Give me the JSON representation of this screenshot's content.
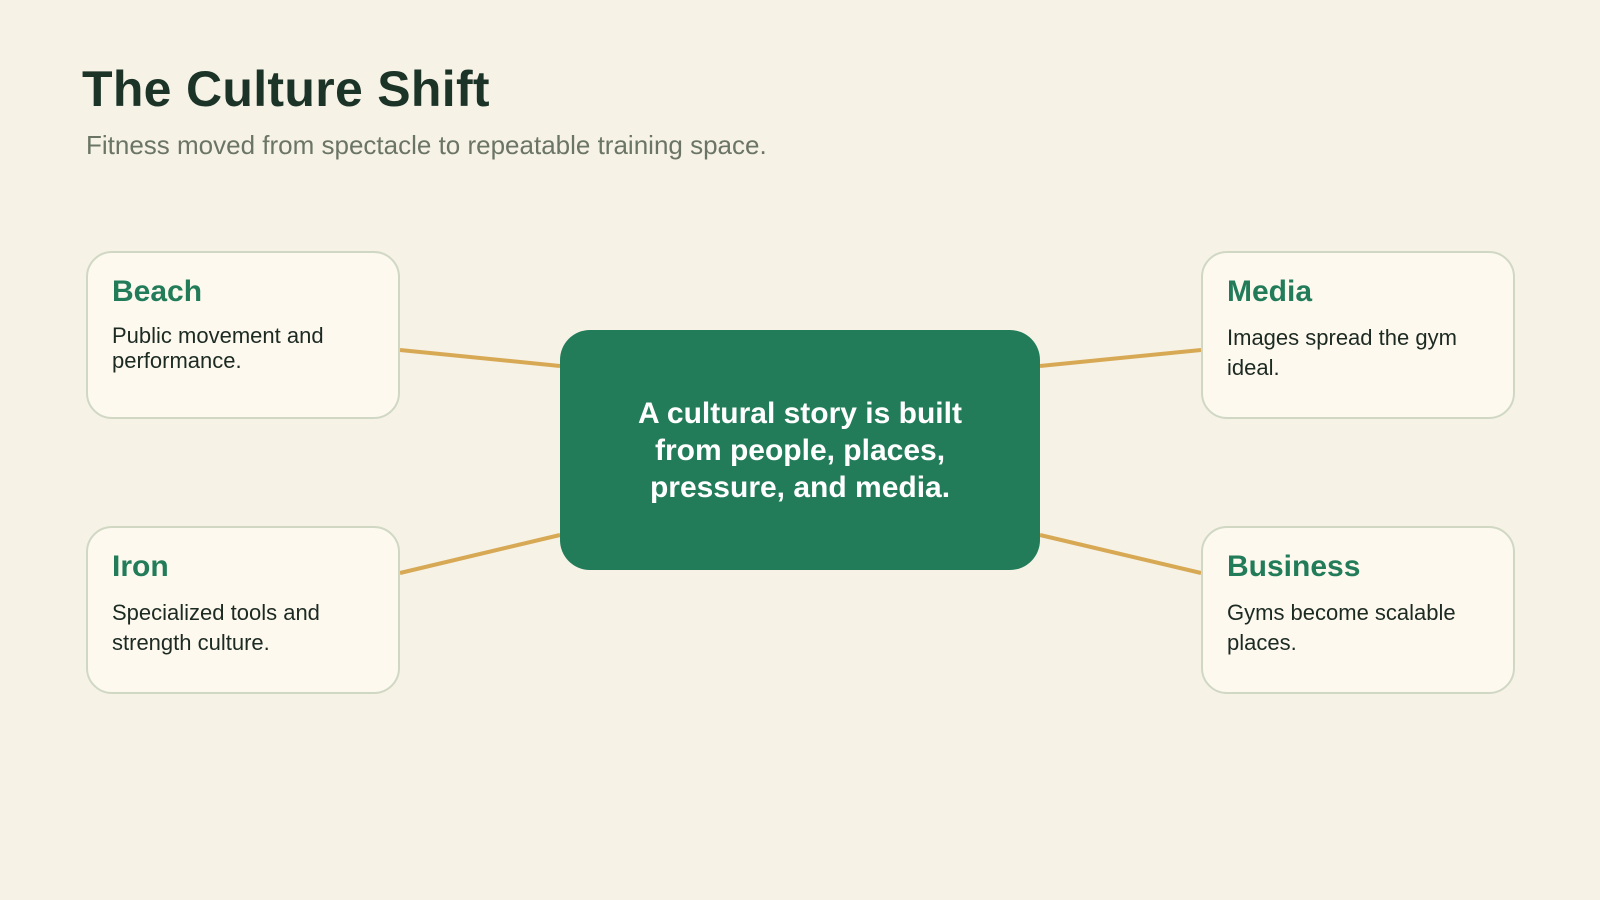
{
  "header": {
    "title": "The Culture Shift",
    "subtitle": "Fitness moved from spectacle to repeatable training space."
  },
  "center": {
    "text": "A cultural story is built from people, places, pressure, and media."
  },
  "cards": [
    {
      "title": "Beach",
      "text": "Public movement and performance."
    },
    {
      "title": "Media",
      "text": "Images spread the gym ideal."
    },
    {
      "title": "Iron",
      "text": "Specialized tools and strength culture."
    },
    {
      "title": "Business",
      "text": "Gyms become scalable places."
    }
  ],
  "colors": {
    "background": "#f6f2e6",
    "accent": "#227c59",
    "connector": "#d8a955",
    "card_border": "#d0d8c4"
  }
}
